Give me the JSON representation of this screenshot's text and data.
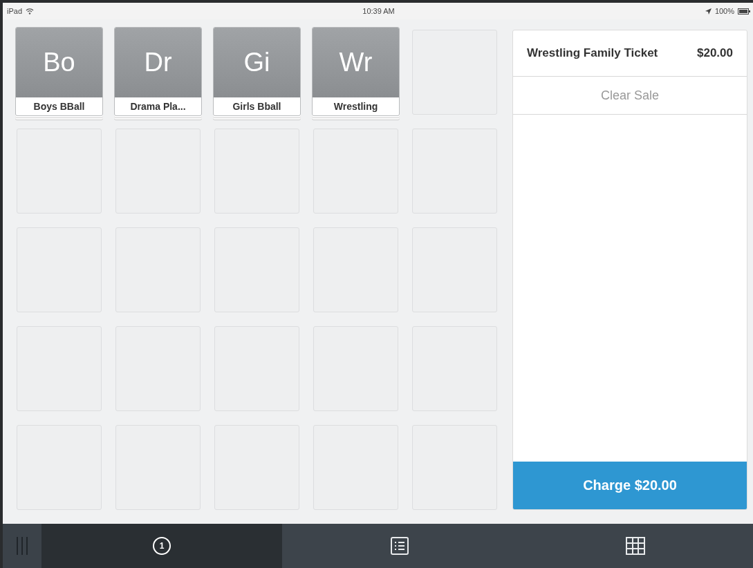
{
  "status_bar": {
    "device": "iPad",
    "time": "10:39 AM",
    "battery": "100%"
  },
  "tiles": [
    {
      "kind": "item",
      "abbr": "Bo",
      "label": "Boys BBall"
    },
    {
      "kind": "item",
      "abbr": "Dr",
      "label": "Drama Pla..."
    },
    {
      "kind": "item",
      "abbr": "Gi",
      "label": "Girls Bball"
    },
    {
      "kind": "item",
      "abbr": "Wr",
      "label": "Wrestling"
    },
    {
      "kind": "empty"
    },
    {
      "kind": "empty"
    },
    {
      "kind": "empty"
    },
    {
      "kind": "empty"
    },
    {
      "kind": "empty"
    },
    {
      "kind": "empty"
    },
    {
      "kind": "empty"
    },
    {
      "kind": "empty"
    },
    {
      "kind": "empty"
    },
    {
      "kind": "empty"
    },
    {
      "kind": "empty"
    },
    {
      "kind": "empty"
    },
    {
      "kind": "empty"
    },
    {
      "kind": "empty"
    },
    {
      "kind": "empty"
    },
    {
      "kind": "empty"
    },
    {
      "kind": "empty"
    },
    {
      "kind": "empty"
    },
    {
      "kind": "empty"
    },
    {
      "kind": "empty"
    },
    {
      "kind": "empty"
    }
  ],
  "cart": {
    "items": [
      {
        "name": "Wrestling Family Ticket",
        "price": "$20.00"
      }
    ],
    "clear_label": "Clear Sale",
    "charge_label": "Charge $20.00"
  },
  "tabs": [
    {
      "kind": "counter",
      "badge": "1",
      "selected": true
    },
    {
      "kind": "list",
      "selected": false
    },
    {
      "kind": "grid",
      "selected": false
    }
  ]
}
